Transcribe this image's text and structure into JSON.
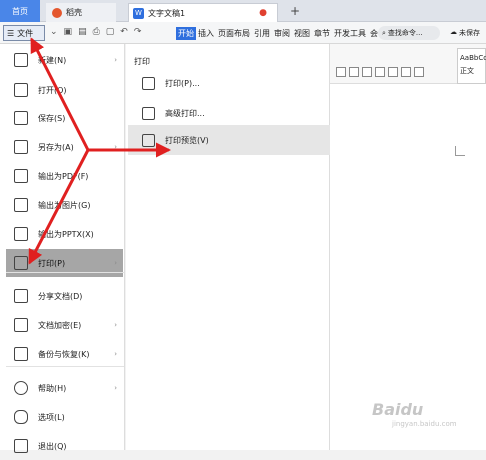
{
  "tabs": {
    "home": "首页",
    "draft": "稻壳",
    "doc": "文字文稿1",
    "new_tab": "+",
    "close": "●"
  },
  "toolbar": {
    "file_label": "文件",
    "ribbon_tabs": [
      "开始",
      "插入",
      "页面布局",
      "引用",
      "审阅",
      "视图",
      "章节",
      "开发工具",
      "会"
    ],
    "search_placeholder": "查找命令...",
    "unsaved": "未保存",
    "style_preview": "AaBbCcDd",
    "style_name": "正文"
  },
  "left_menu": [
    {
      "label": "新建(N)",
      "icon": "new-doc-icon",
      "arrow": true
    },
    {
      "label": "打开(O)",
      "icon": "folder-icon",
      "arrow": false
    },
    {
      "label": "保存(S)",
      "icon": "save-icon",
      "arrow": false
    },
    {
      "label": "另存为(A)",
      "icon": "save-as-icon",
      "arrow": true
    },
    {
      "label": "输出为PDF(F)",
      "icon": "pdf-icon",
      "arrow": false
    },
    {
      "label": "输出为图片(G)",
      "icon": "image-icon",
      "arrow": false
    },
    {
      "label": "输出为PPTX(X)",
      "icon": "pptx-icon",
      "arrow": false
    },
    {
      "label": "打印(P)",
      "icon": "print-icon",
      "arrow": true
    },
    {
      "label": "分享文档(D)",
      "icon": "share-icon",
      "arrow": false
    },
    {
      "label": "文档加密(E)",
      "icon": "encrypt-icon",
      "arrow": true
    },
    {
      "label": "备份与恢复(K)",
      "icon": "backup-icon",
      "arrow": true
    },
    {
      "label": "帮助(H)",
      "icon": "help-icon",
      "arrow": true
    },
    {
      "label": "选项(L)",
      "icon": "gear-icon",
      "arrow": false
    },
    {
      "label": "退出(Q)",
      "icon": "exit-icon",
      "arrow": false
    }
  ],
  "submenu": {
    "title": "打印",
    "items": [
      {
        "label": "打印(P)...",
        "icon": "printer-icon"
      },
      {
        "label": "高级打印...",
        "icon": "advanced-print-icon"
      },
      {
        "label": "打印预览(V)",
        "icon": "print-preview-icon"
      }
    ]
  },
  "watermark": {
    "brand": "Baidu",
    "sub": "jingyan.baidu.com"
  },
  "colors": {
    "accent": "#2f6fde",
    "arrow": "#e02020",
    "selected": "#a6a6a6"
  }
}
